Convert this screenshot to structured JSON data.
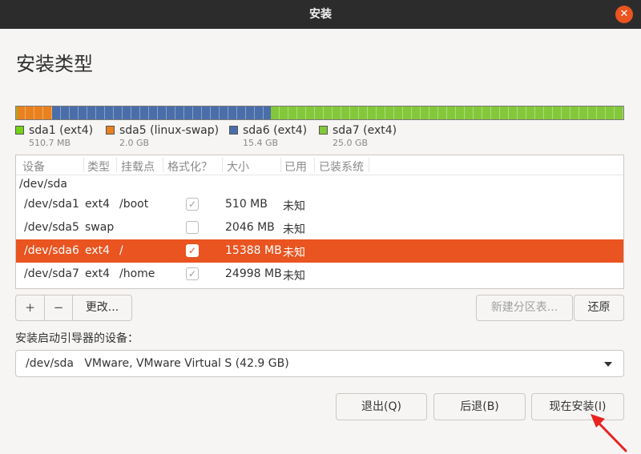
{
  "window": {
    "title": "安装"
  },
  "page": {
    "heading": "安装类型"
  },
  "partition_legend": [
    {
      "name": "sda1 (ext4)",
      "size": "510.7 MB",
      "color": "#73d216"
    },
    {
      "name": "sda5 (linux-swap)",
      "size": "2.0 GB",
      "color": "#e9811e"
    },
    {
      "name": "sda6 (ext4)",
      "size": "15.4 GB",
      "color": "#4a6ea9"
    },
    {
      "name": "sda7 (ext4)",
      "size": "25.0 GB",
      "color": "#83c83a"
    }
  ],
  "table": {
    "columns": [
      "设备",
      "类型",
      "挂载点",
      "格式化？",
      "大小",
      "已用",
      "已装系统"
    ],
    "disk": "/dev/sda",
    "rows": [
      {
        "device": "/dev/sda1",
        "type": "ext4",
        "mount": "/boot",
        "format": true,
        "size": "510 MB",
        "used": "未知",
        "selected": false
      },
      {
        "device": "/dev/sda5",
        "type": "swap",
        "mount": "",
        "format": false,
        "size": "2046 MB",
        "used": "未知",
        "selected": false
      },
      {
        "device": "/dev/sda6",
        "type": "ext4",
        "mount": "/",
        "format": true,
        "size": "15388 MB",
        "used": "未知",
        "selected": true
      },
      {
        "device": "/dev/sda7",
        "type": "ext4",
        "mount": "/home",
        "format": true,
        "size": "24998 MB",
        "used": "未知",
        "selected": false
      }
    ]
  },
  "toolbar": {
    "add": "+",
    "remove": "−",
    "change": "更改..."
  },
  "actions": {
    "new_table": "新建分区表...",
    "revert": "还原"
  },
  "bootloader": {
    "label": "安装启动引导器的设备：",
    "value": "/dev/sda   VMware, VMware Virtual S (42.9 GB)"
  },
  "footer": {
    "quit": "退出(Q)",
    "back": "后退(B)",
    "install": "现在安装(I)"
  },
  "colors": {
    "accent": "#e95420",
    "titlebar": "#2c2c2c",
    "annotation_arrow": "#e8231f"
  }
}
